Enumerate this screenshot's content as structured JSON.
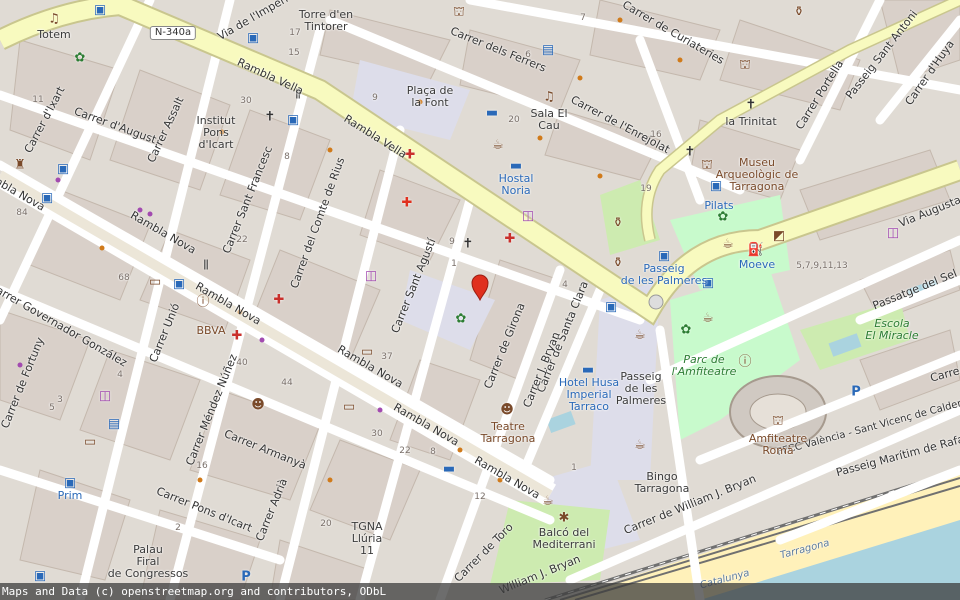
{
  "map": {
    "attribution": "Maps and Data (c) openstreetmap.org and contributors, ODbL",
    "road_ref": "N-340a",
    "streets": {
      "via_imperi": "Via de l'Imperi",
      "rambla_vella_1": "Rambla Vella",
      "rambla_vella_2": "Rambla Vella",
      "rambla_nova_1": "Rambla Nova",
      "rambla_nova_2": "Rambla Nova",
      "rambla_nova_3": "Rambla Nova",
      "rambla_nova_4": "Rambla Nova",
      "rambla_nova_5": "Rambla Nova",
      "rambla_nova_6": "Rambla Nova",
      "carrer_ixart": "Carrer d'Ixart",
      "carrer_august": "Carrer d'August",
      "carrer_assalt": "Carrer Assalt",
      "carrer_sant_francesc": "Carrer Sant Francesc",
      "carrer_comte_rius": "Carrer del Comte de Rius",
      "carrer_sant_agusti": "Carrer Sant Agustí",
      "carrer_girona": "Carrer de Girona",
      "carrer_santa_clara": "Carrer de Santa Clara",
      "carrer_gov_gonzalez": "Carrer Governador González",
      "carrer_fortuny": "Carrer de Fortuny",
      "carrer_unio": "Carrer Unió",
      "carrer_mendez_nunez": "Carrer Méndez Núñez",
      "carrer_armanya": "Carrer Armanyà",
      "carrer_adria": "Carrer Adrià",
      "carrer_pons_icart": "Carrer Pons d'Icart",
      "carrer_toro": "Carrer de Toro",
      "carrer_j_bryan": "Carrer J. Bryan",
      "carrer_william_bryan": "Carrer de William J. Bryan",
      "william_j_bryan": "William J. Bryan",
      "carrer_ferrers": "Carrer dels Ferrers",
      "carrer_enrejolat": "Carrer de l'Enrejolat",
      "carrer_curiateries": "Carrer de Curiateries",
      "carrer_portella": "Carrer Portella",
      "passeig_sant_antoni": "Passeig Sant Antoni",
      "carrer_huya": "Carrer d'Huya",
      "via_augusta": "Via Augusta",
      "passatge_sel": "Passatge del Sel",
      "carrer_right": "Carre",
      "passeig_maritim": "Passeig Marítim de Rafael",
      "ffcc": "FFCC València - Sant Vicenç de Calders",
      "tarragona_beach": "Tarragona",
      "catalunya": "Catalunya"
    },
    "places": {
      "totem": "Totem",
      "torre_tintorer": "Torre d'en\nTintorer",
      "placa_font": "Plaça de\nla Font",
      "sala_el_cau": "Sala El\nCau",
      "la_trinitat": "la Trinitat",
      "institut": "Institut\nPons\nd'Icart",
      "museu": "Museu\nArqueològic de\nTarragona",
      "hostal_noria": "Hostal\nNoria",
      "pilats": "Pilats",
      "passeig_palmeres_stop": "Passeig\nde les Palmeres",
      "moeve": "Moeve",
      "escola_miracle": "Escola\nEl Miracle",
      "parc_amfiteatre": "Parc de\nl'Amfiteatre",
      "amfiteatre": "Amfiteatre\nRomà",
      "passeig_palmeres": "Passeig\nde les\nPalmeres",
      "hotel_husa": "Hotel Husa\nImperial\nTarraco",
      "teatre": "Teatre\nTarragona",
      "bingo": "Bingo\nTarragona",
      "balco": "Balcó del\nMediterrani",
      "bbva": "BBVA",
      "prim": "Prim",
      "tgna": "TGNA\nLlúria\n11",
      "palau": "Palau\nFiral\nde Congressos"
    },
    "house_numbers": [
      "30",
      "17",
      "15",
      "9",
      "8",
      "6",
      "7",
      "5",
      "84",
      "22",
      "68",
      "4",
      "3",
      "40",
      "37",
      "44",
      "30",
      "22",
      "12",
      "20",
      "16",
      "2",
      "1",
      "4",
      "16",
      "19",
      "20",
      "1",
      "5,7,9,11,13",
      "8",
      "9",
      "11"
    ],
    "marker": {
      "type": "red-location-pin"
    },
    "colors": {
      "land": "#e0dbd4",
      "building": "#d9d0c9",
      "primary_road": "#f8fabf",
      "primary_casing": "#c9c68e",
      "pedestrian": "#ddddea",
      "park": "#c8facc",
      "grass": "#cdebb0",
      "beach": "#fff1ba",
      "water": "#aad3df",
      "rail": "#707070",
      "marker": "#e0301e"
    }
  }
}
